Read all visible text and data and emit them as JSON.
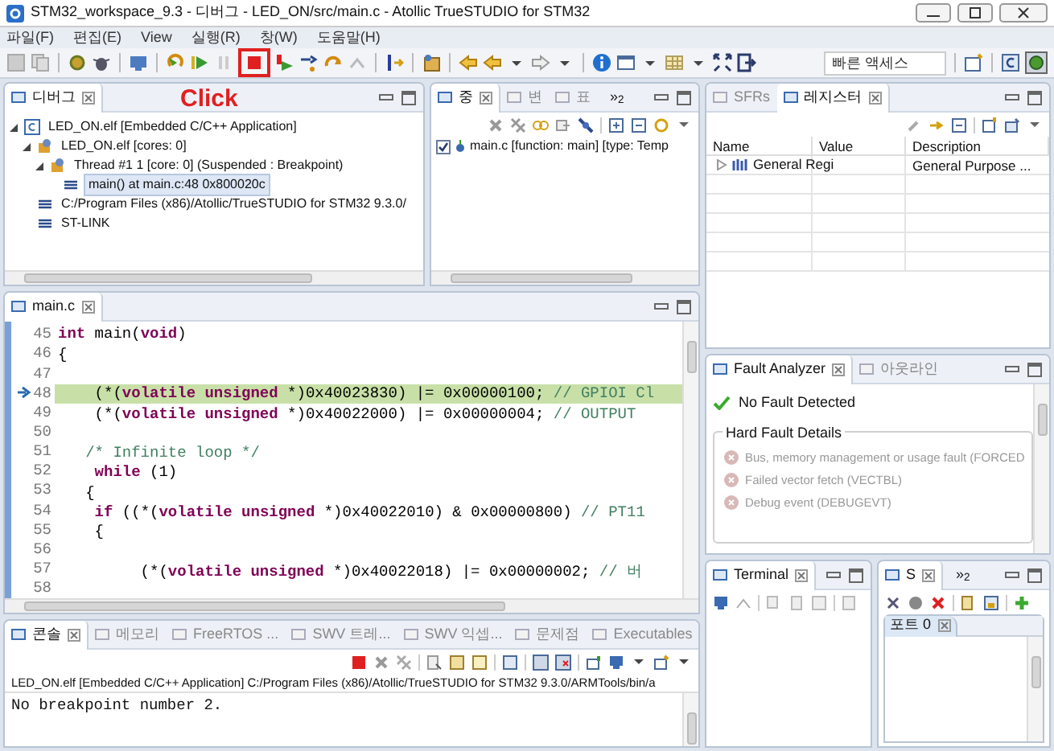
{
  "window": {
    "title": "STM32_workspace_9.3 - 디버그 - LED_ON/src/main.c - Atollic TrueSTUDIO for STM32"
  },
  "menu": [
    "파일(F)",
    "편집(E)",
    "View",
    "실행(R)",
    "창(W)",
    "도움말(H)"
  ],
  "toolbar": {
    "quick_access": {
      "placeholder": "빠른 액세스"
    }
  },
  "annotation": {
    "text": "Click"
  },
  "debug_panel": {
    "tabs": [
      {
        "label": "디버그",
        "selected": true
      }
    ],
    "tree": [
      {
        "label": "LED_ON.elf [Embedded C/C++ Application]",
        "expanded": true,
        "selected": false,
        "children": [
          {
            "label": "LED_ON.elf [cores: 0]",
            "expanded": true,
            "selected": false,
            "children": [
              {
                "label": "Thread #1 1 [core: 0] (Suspended : Breakpoint)",
                "expanded": true,
                "selected": false,
                "children": [
                  {
                    "label": "main() at main.c:48 0x800020c",
                    "selected": true
                  }
                ]
              }
            ]
          },
          {
            "label": "C:/Program Files (x86)/Atollic/TrueSTUDIO for STM32 9.3.0/",
            "selected": false
          },
          {
            "label": "ST-LINK",
            "selected": false
          }
        ]
      }
    ]
  },
  "breakpoints_panel": {
    "tabs": [
      {
        "label": "중",
        "selected": true
      },
      {
        "label": "변",
        "selected": false
      },
      {
        "label": "표",
        "selected": false
      }
    ],
    "overflow": "»$_{2}$",
    "breakpoints": [
      {
        "label": "main.c [function: main] [type: Temp",
        "checked": true
      }
    ]
  },
  "registers_panel": {
    "tabs": [
      {
        "label": "SFRs",
        "selected": false
      },
      {
        "label": "레지스터",
        "selected": true
      }
    ],
    "columns": [
      "Name",
      "Value",
      "Description"
    ],
    "rows": [
      {
        "name": "General Regi",
        "description": "General Purpose ...",
        "expanded": false
      }
    ]
  },
  "editor": {
    "tabs": [
      {
        "label": "main.c",
        "selected": true
      }
    ],
    "lines": [
      {
        "number": "45",
        "current": false,
        "tokens": [
          {
            "kind": "keyword",
            "text": "int"
          },
          {
            "kind": "plain",
            "text": " main("
          },
          {
            "kind": "keyword",
            "text": "void"
          },
          {
            "kind": "plain",
            "text": ")"
          }
        ]
      },
      {
        "number": "46",
        "current": false,
        "tokens": [
          {
            "kind": "plain",
            "text": "{"
          }
        ]
      },
      {
        "number": "47",
        "current": false
      },
      {
        "number": "48",
        "current": true,
        "tokens": [
          {
            "kind": "plain",
            "text": "    (*("
          },
          {
            "kind": "keyword",
            "text": "volatile unsigned"
          },
          {
            "kind": "plain",
            "text": " *)0x40023830) |= 0x00000100; "
          },
          {
            "kind": "comment",
            "text": "// GPIOI Cl"
          }
        ]
      },
      {
        "number": "49",
        "current": false,
        "tokens": [
          {
            "kind": "plain",
            "text": "    (*("
          },
          {
            "kind": "keyword",
            "text": "volatile unsigned"
          },
          {
            "kind": "plain",
            "text": " *)0x40022000) |= 0x00000004; "
          },
          {
            "kind": "comment",
            "text": "// OUTPUT"
          }
        ]
      },
      {
        "number": "50",
        "current": false
      },
      {
        "number": "51",
        "current": false,
        "tokens": [
          {
            "kind": "comment",
            "text": "   /* Infinite loop */"
          }
        ]
      },
      {
        "number": "52",
        "current": false,
        "tokens": [
          {
            "kind": "keyword",
            "text": "    while"
          },
          {
            "kind": "plain",
            "text": " (1)"
          }
        ]
      },
      {
        "number": "53",
        "current": false,
        "tokens": [
          {
            "kind": "plain",
            "text": "   {"
          }
        ]
      },
      {
        "number": "54",
        "current": false,
        "tokens": [
          {
            "kind": "keyword",
            "text": "    if"
          },
          {
            "kind": "plain",
            "text": " ((*("
          },
          {
            "kind": "keyword",
            "text": "volatile unsigned"
          },
          {
            "kind": "plain",
            "text": " *)0x40022010) & 0x00000800) "
          },
          {
            "kind": "comment",
            "text": "// PT11"
          }
        ]
      },
      {
        "number": "55",
        "current": false,
        "tokens": [
          {
            "kind": "plain",
            "text": "    {"
          }
        ]
      },
      {
        "number": "56",
        "current": false
      },
      {
        "number": "57",
        "current": false,
        "tokens": [
          {
            "kind": "plain",
            "text": "         (*("
          },
          {
            "kind": "keyword",
            "text": "volatile unsigned"
          },
          {
            "kind": "plain",
            "text": " *)0x40022018) |= 0x00000002; "
          },
          {
            "kind": "comment",
            "text": "// 버"
          }
        ]
      },
      {
        "number": "58",
        "current": false
      }
    ]
  },
  "fault_panel": {
    "tabs": [
      {
        "label": "Fault Analyzer",
        "selected": true
      },
      {
        "label": "아웃라인",
        "selected": false
      }
    ],
    "status": "No Fault Detected",
    "group": {
      "title": "Hard Fault Details",
      "items": [
        {
          "label": "Bus, memory management or usage fault (FORCED",
          "detected": false
        },
        {
          "label": "Failed vector fetch (VECTBL)",
          "detected": false
        },
        {
          "label": "Debug event (DEBUGEVT)",
          "detected": false
        }
      ]
    }
  },
  "terminal_panel": {
    "tabs": [
      {
        "label": "Terminal",
        "selected": true
      }
    ]
  },
  "serial_panel": {
    "tabs": [
      {
        "label": "S",
        "selected": true
      }
    ],
    "overflow": "»$_{2}$",
    "subtabs": [
      {
        "label": "포트 0",
        "selected": true
      }
    ]
  },
  "console_panel": {
    "tabs": [
      {
        "label": "콘솔",
        "selected": true
      },
      {
        "label": "메모리",
        "selected": false
      },
      {
        "label": "FreeRTOS ...",
        "selected": false
      },
      {
        "label": "SWV 트레...",
        "selected": false
      },
      {
        "label": "SWV 익셉...",
        "selected": false
      },
      {
        "label": "문제점",
        "selected": false
      },
      {
        "label": "Executables",
        "selected": false
      }
    ],
    "header": "LED_ON.elf [Embedded C/C++ Application] C:/Program Files (x86)/Atollic/TrueSTUDIO for STM32 9.3.0/ARMTools/bin/a",
    "output": [
      "No breakpoint number 2."
    ]
  }
}
